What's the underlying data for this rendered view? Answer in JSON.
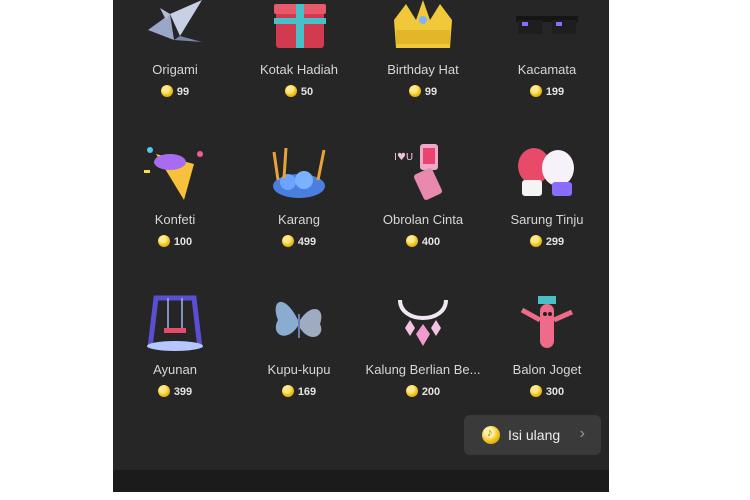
{
  "gifts": [
    {
      "name": "Origami",
      "price": "99",
      "icon": "origami-crane-icon"
    },
    {
      "name": "Kotak Hadiah",
      "price": "50",
      "icon": "gift-box-icon"
    },
    {
      "name": "Birthday Hat",
      "price": "99",
      "icon": "birthday-crown-icon"
    },
    {
      "name": "Kacamata",
      "price": "199",
      "icon": "pixel-sunglasses-icon"
    },
    {
      "name": "Konfeti",
      "price": "100",
      "icon": "confetti-popper-icon"
    },
    {
      "name": "Karang",
      "price": "499",
      "icon": "coral-icon"
    },
    {
      "name": "Obrolan Cinta",
      "price": "400",
      "icon": "love-flip-phone-icon"
    },
    {
      "name": "Sarung Tinju",
      "price": "299",
      "icon": "boxing-gloves-icon"
    },
    {
      "name": "Ayunan",
      "price": "399",
      "icon": "swing-icon"
    },
    {
      "name": "Kupu-kupu",
      "price": "169",
      "icon": "butterfly-icon"
    },
    {
      "name": "Kalung Berlian Be...",
      "price": "200",
      "icon": "diamond-necklace-icon"
    },
    {
      "name": "Balon Joget",
      "price": "300",
      "icon": "dancing-balloon-icon"
    }
  ],
  "refill": {
    "label": "Isi ulang",
    "icon": "coin-icon",
    "chevron": "chevron-right-icon"
  },
  "colors": {
    "panel": "#262626",
    "text": "#d6d6d6",
    "coin": "#f2c21b",
    "button": "#3a3a3a"
  }
}
